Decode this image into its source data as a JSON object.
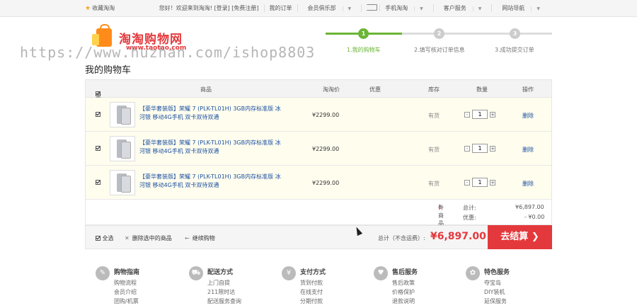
{
  "topbar": {
    "favorite": "收藏淘淘",
    "links": [
      "您好！欢迎来到淘淘! [登录] [免费注册]",
      "我的订单",
      "会员俱乐部",
      "手机淘淘",
      "客户服务",
      "网站导航"
    ]
  },
  "logo": {
    "name": "淘淘购物网",
    "domain": "www.taotao.com"
  },
  "watermark": "https://www.huzhan.com/ishop8803",
  "page_title": "我的购物车",
  "steps": [
    {
      "num": "1",
      "label": "1.我的购物车"
    },
    {
      "num": "2",
      "label": "2.填写核对订单信息"
    },
    {
      "num": "3",
      "label": "3.成功提交订单"
    }
  ],
  "table_headers": {
    "select_all": "全选",
    "product": "商品",
    "price": "淘淘价",
    "discount": "优惠",
    "stock": "库存",
    "quantity": "数量",
    "action": "操作"
  },
  "items": [
    {
      "name": "【豪华套装版】荣耀 7 (PLK-TL01H) 3GB内存标准版 冰河银 移动4G手机 双卡双待双通",
      "price": "¥2299.00",
      "stock": "有货",
      "qty": "1",
      "delete": "删除"
    },
    {
      "name": "【豪华套装版】荣耀 7 (PLK-TL01H) 3GB内存标准版 冰河银 移动4G手机 双卡双待双通",
      "price": "¥2299.00",
      "stock": "有货",
      "qty": "1",
      "delete": "删除"
    },
    {
      "name": "【豪华套装版】荣耀 7 (PLK-TL01H) 3GB内存标准版 冰河银 移动4G手机 双卡双待双通",
      "price": "¥2299.00",
      "stock": "有货",
      "qty": "1",
      "delete": "删除"
    }
  ],
  "summary": {
    "count": "1",
    "count_label": "件商品",
    "total_label": "总计:",
    "total": "¥6,897.00",
    "discount_label": "优惠:",
    "discount": "- ¥0.00"
  },
  "footbar": {
    "select_all": "全选",
    "delete_selected": "删除选中的商品",
    "continue": "继续购物",
    "total_label": "总计（不含运费）:",
    "amount": "¥6,897.00",
    "checkout": "去结算"
  },
  "services": [
    {
      "title": "购物指南",
      "icon": "✎",
      "links": [
        "购物流程",
        "会员介绍",
        "团购/机票"
      ]
    },
    {
      "title": "配送方式",
      "icon": "⛟",
      "links": [
        "上门自提",
        "211限时达",
        "配送服务查询"
      ]
    },
    {
      "title": "支付方式",
      "icon": "¥",
      "links": [
        "货到付款",
        "在线支付",
        "分期付款"
      ]
    },
    {
      "title": "售后服务",
      "icon": "♥",
      "links": [
        "售后政策",
        "价格保护",
        "退款说明"
      ]
    },
    {
      "title": "特色服务",
      "icon": "✿",
      "links": [
        "夺宝岛",
        "DIY装机",
        "延保服务"
      ]
    }
  ]
}
